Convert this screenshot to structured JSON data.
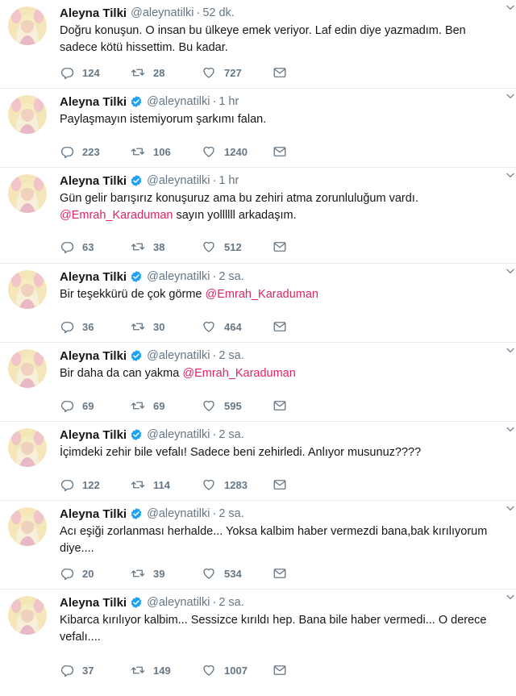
{
  "author": {
    "name": "Aleyna Tilki",
    "handle": "@aleynatilki",
    "separator": "·"
  },
  "colors": {
    "mention": "#e0245e",
    "verified": "#1da1f2",
    "muted": "#657786",
    "divider": "#e6ecf0"
  },
  "tweets": [
    {
      "time": "52 dk.",
      "lines": [
        "Doğru konuşun. O insan bu ülkeye emek veriyor. Laf edin diye yazmadım. Ben",
        "sadece kötü hissettim. Bu kadar."
      ],
      "mention": "",
      "replies": "124",
      "retweets": "28",
      "likes": "727"
    },
    {
      "time": "1 hr",
      "lines": [
        "Paylaşmayın istemiyorum şarkımı falan."
      ],
      "mention": "",
      "replies": "223",
      "retweets": "106",
      "likes": "1240"
    },
    {
      "time": "1 hr",
      "lines": [
        "Gün gelir barışırız konuşuruz ama bu zehiri atma zorunluluğum vardı."
      ],
      "mention": "@Emrah_Karaduman",
      "after_mention": " sayın yollllll arkadaşım.",
      "mention_newline": true,
      "replies": "63",
      "retweets": "38",
      "likes": "512"
    },
    {
      "time": "2 sa.",
      "lines": [
        "Bir teşekkürü de çok görme "
      ],
      "mention": "@Emrah_Karaduman",
      "after_mention": "",
      "replies": "36",
      "retweets": "30",
      "likes": "464"
    },
    {
      "time": "2 sa.",
      "lines": [
        "Bir daha da can yakma "
      ],
      "mention": "@Emrah_Karaduman",
      "after_mention": "",
      "replies": "69",
      "retweets": "69",
      "likes": "595"
    },
    {
      "time": "2 sa.",
      "lines": [
        "İçimdeki zehir bile vefalı! Sadece beni zehirledi. Anlıyor musunuz????"
      ],
      "mention": "",
      "replies": "122",
      "retweets": "114",
      "likes": "1283"
    },
    {
      "time": "2 sa.",
      "lines": [
        "Acı eşiği zorlanması herhalde... Yoksa kalbim haber vermezdi bana,bak kırılıyorum",
        "diye...."
      ],
      "mention": "",
      "replies": "20",
      "retweets": "39",
      "likes": "534"
    },
    {
      "time": "2 sa.",
      "lines": [
        "Kibarca kırılıyor kalbim... Sessizce kırıldı hep. Bana bile haber vermedi... O derece",
        "vefalı...."
      ],
      "mention": "",
      "replies": "37",
      "retweets": "149",
      "likes": "1007"
    }
  ]
}
